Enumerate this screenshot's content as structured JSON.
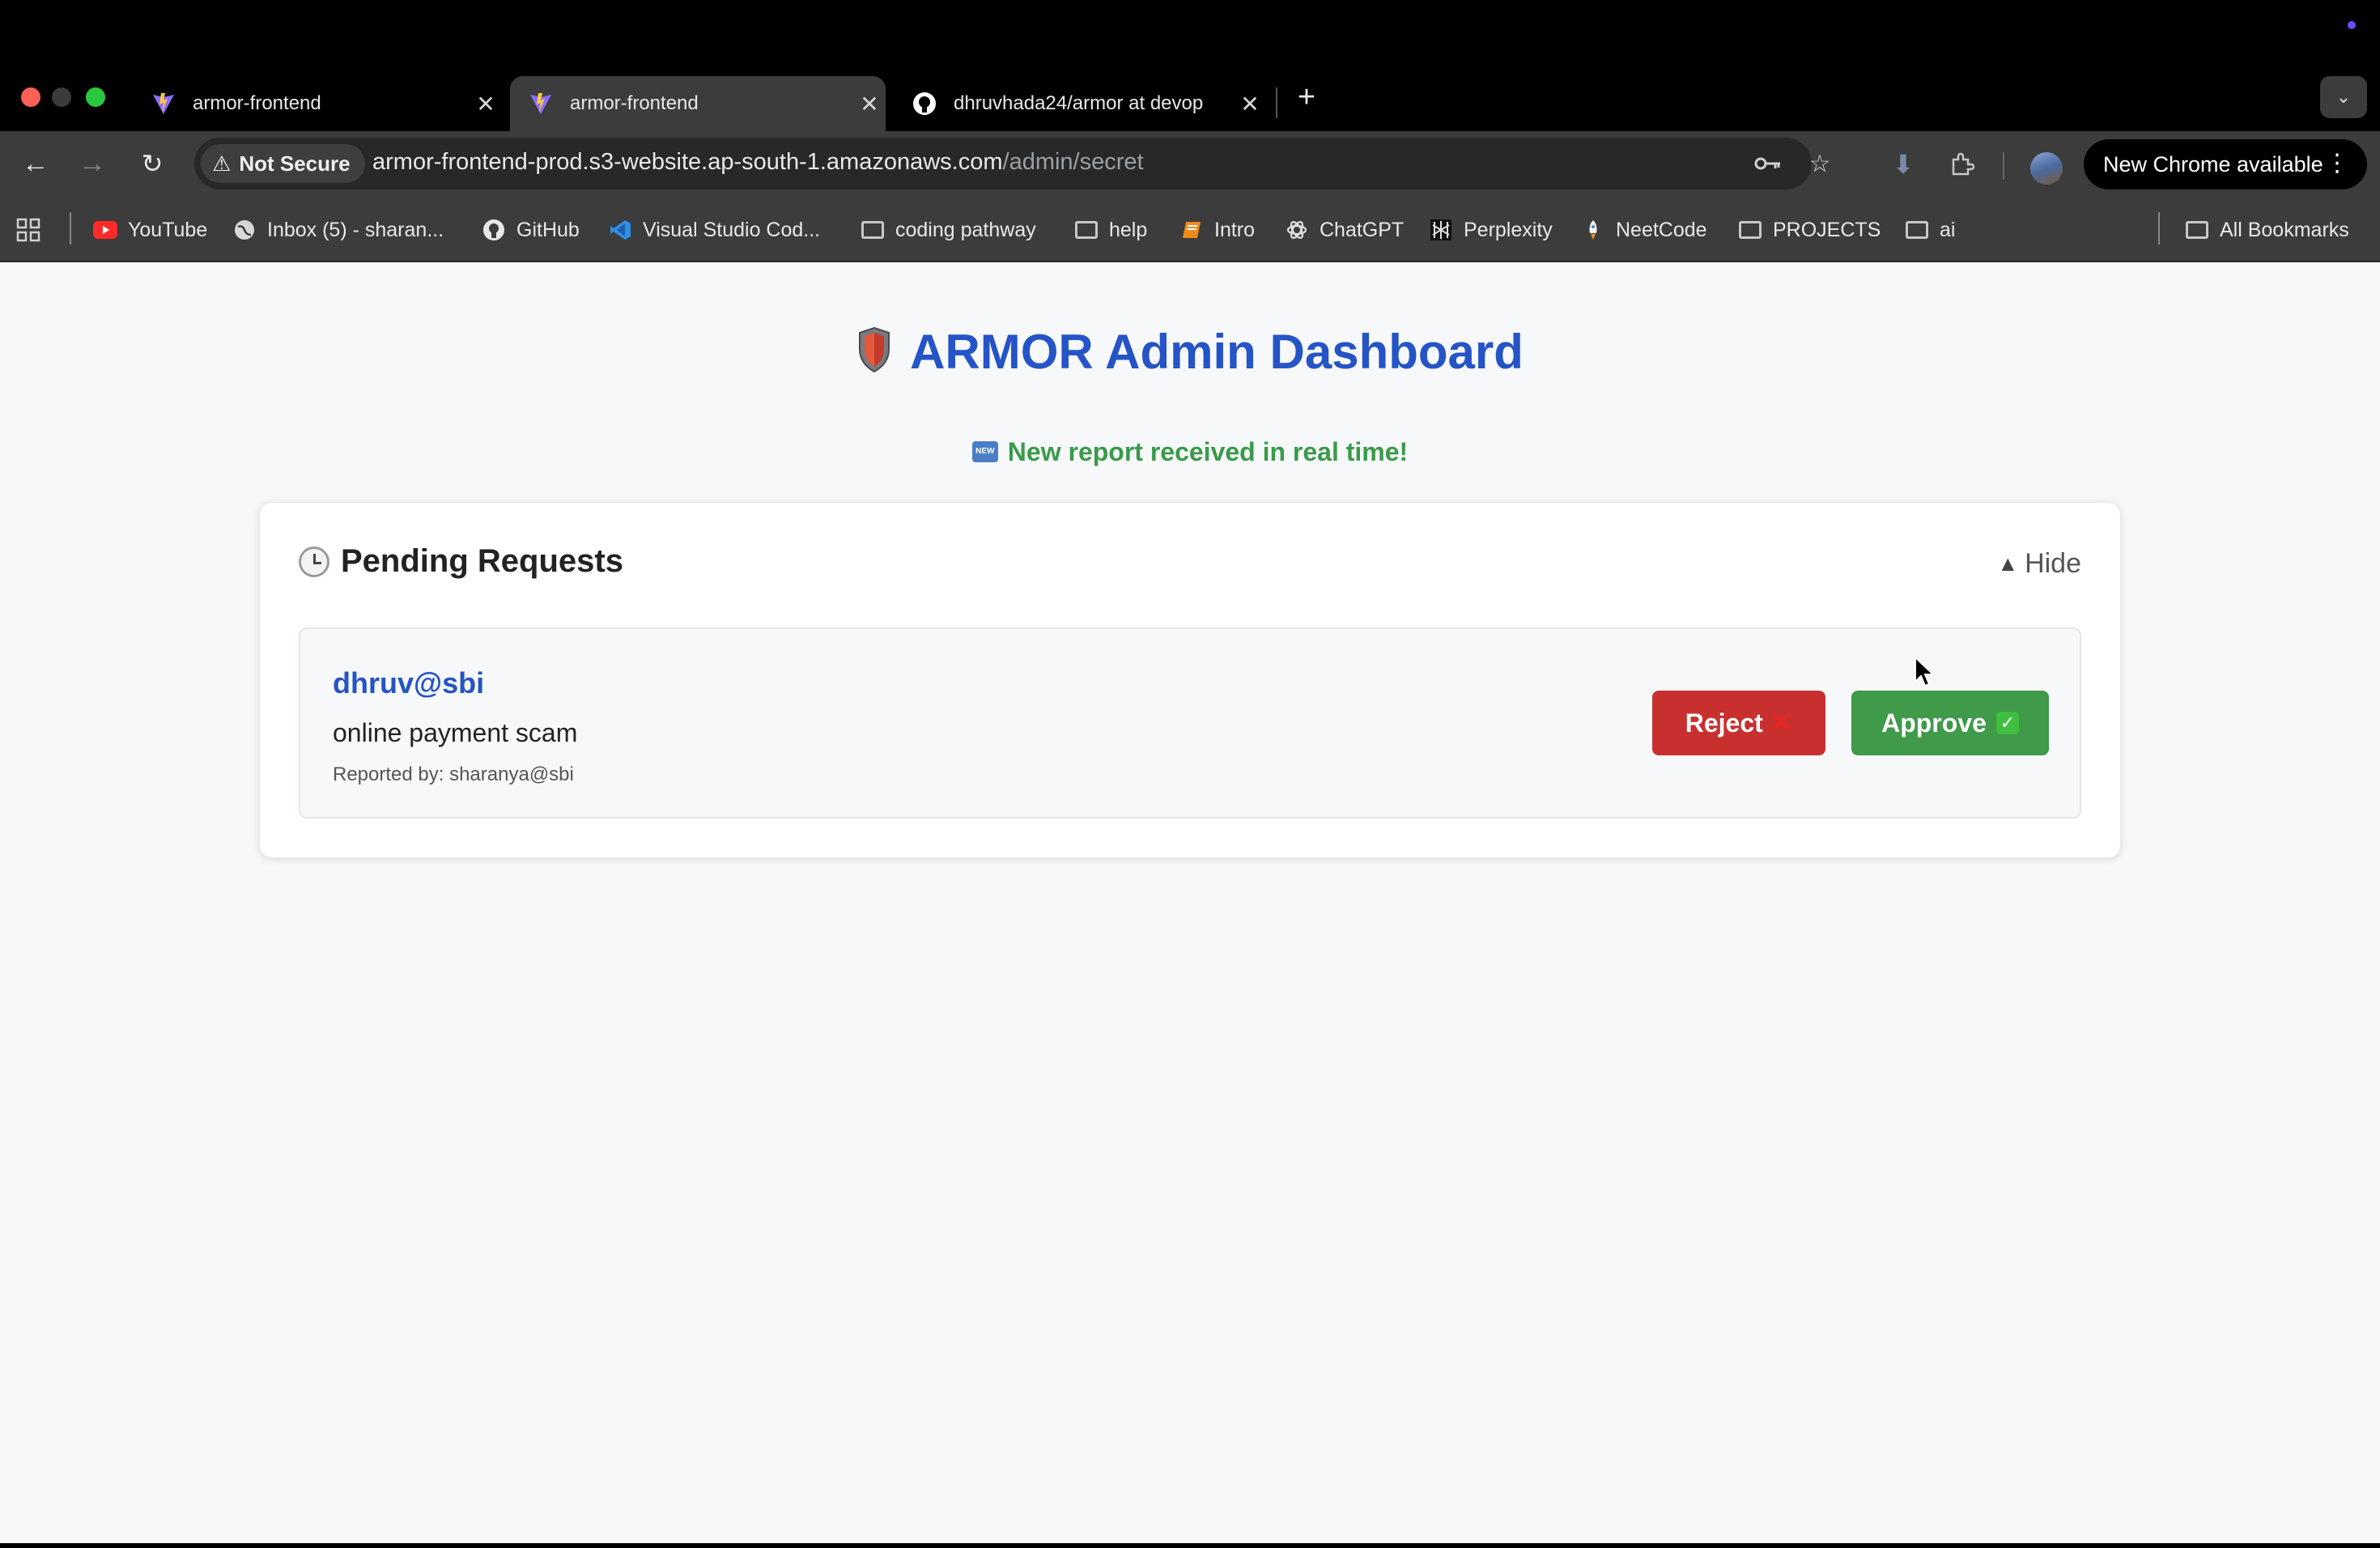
{
  "browser": {
    "tabs": [
      {
        "title": "armor-frontend",
        "favicon": "vite-icon",
        "active": false
      },
      {
        "title": "armor-frontend",
        "favicon": "vite-icon",
        "active": true
      },
      {
        "title": "dhruvhada24/armor at devop",
        "favicon": "github-icon",
        "active": false
      }
    ],
    "security_label": "Not Secure",
    "url_host": "armor-frontend-prod.s3-website.ap-south-1.amazonaws.com",
    "url_path": "/admin/secret",
    "update_label": "New Chrome available",
    "bookmarks": [
      {
        "label": "YouTube",
        "icon": "youtube-icon"
      },
      {
        "label": "Inbox (5) - sharan...",
        "icon": "globe-icon"
      },
      {
        "label": "GitHub",
        "icon": "github-icon"
      },
      {
        "label": "Visual Studio Cod...",
        "icon": "vscode-icon"
      },
      {
        "label": "coding pathway",
        "icon": "folder-icon"
      },
      {
        "label": "help",
        "icon": "folder-icon"
      },
      {
        "label": "Intro",
        "icon": "book-icon"
      },
      {
        "label": "ChatGPT",
        "icon": "chatgpt-icon"
      },
      {
        "label": "Perplexity",
        "icon": "perplexity-icon"
      },
      {
        "label": "NeetCode",
        "icon": "rocket-icon"
      },
      {
        "label": "PROJECTS",
        "icon": "folder-icon"
      },
      {
        "label": "ai",
        "icon": "folder-icon"
      }
    ],
    "all_bookmarks_label": "All Bookmarks"
  },
  "page": {
    "title": "ARMOR Admin Dashboard",
    "notice": "New report received in real time!",
    "pending": {
      "heading": "Pending Requests",
      "toggle_label": "Hide",
      "requests": [
        {
          "user": "dhruv@sbi",
          "description": "online payment scam",
          "reported_by": "Reported by: sharanya@sbi",
          "reject_label": "Reject",
          "approve_label": "Approve"
        }
      ]
    }
  },
  "colors": {
    "title": "#2554c7",
    "notice": "#3a9a4a",
    "reject": "#c83030",
    "approve": "#3f9a4a"
  }
}
